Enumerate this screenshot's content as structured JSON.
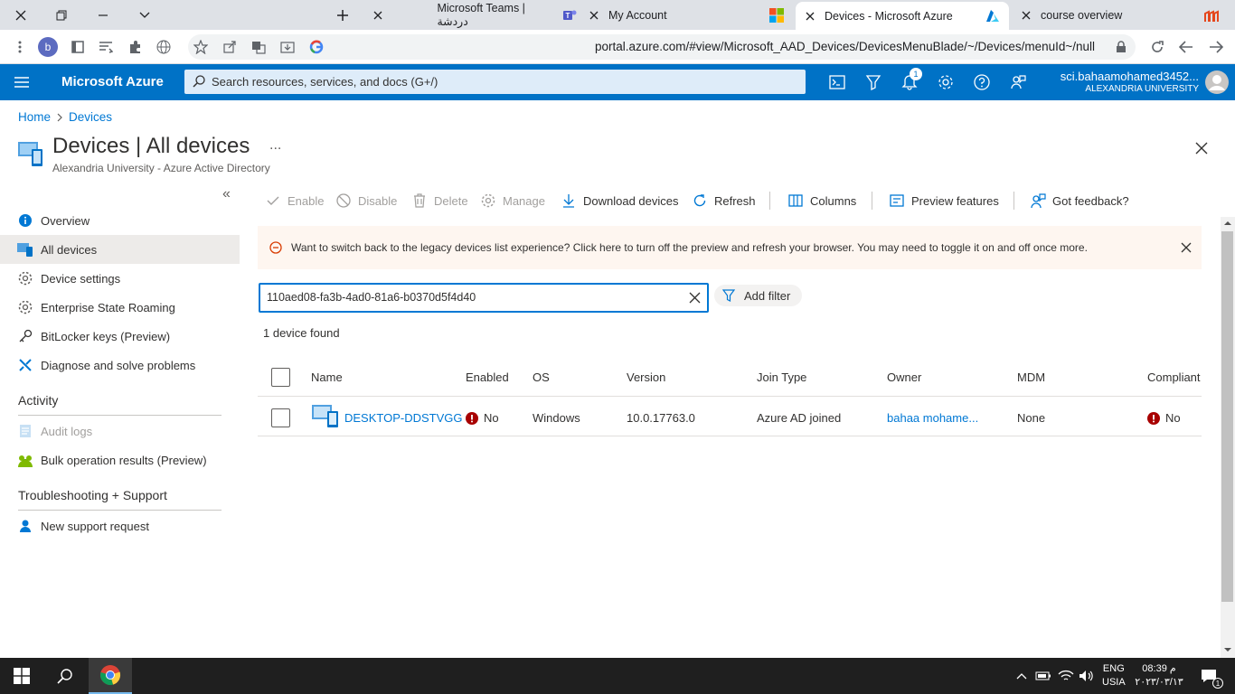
{
  "browser": {
    "tabs": [
      {
        "title": "Microsoft Teams | دردشة"
      },
      {
        "title": "My Account"
      },
      {
        "title": "Devices - Microsoft Azure"
      },
      {
        "title": "course overview"
      }
    ],
    "url": "portal.azure.com/#view/Microsoft_AAD_Devices/DevicesMenuBlade/~/Devices/menuId~/null",
    "profile_letter": "b"
  },
  "azure_header": {
    "brand": "Microsoft Azure",
    "search_placeholder": "Search resources, services, and docs (G+/)",
    "notification_count": "1",
    "account_name": "sci.bahaamohamed3452...",
    "account_org": "ALEXANDRIA UNIVERSITY"
  },
  "breadcrumb": [
    "Home",
    "Devices"
  ],
  "page": {
    "title": "Devices | All devices",
    "more": "...",
    "subtitle": "Alexandria University - Azure Active Directory"
  },
  "sidebar": {
    "collapse": "«",
    "items": [
      {
        "label": "Overview",
        "icon": "info-icon"
      },
      {
        "label": "All devices",
        "icon": "devices-icon",
        "selected": true
      },
      {
        "label": "Device settings",
        "icon": "gear-icon"
      },
      {
        "label": "Enterprise State Roaming",
        "icon": "gear-icon"
      },
      {
        "label": "BitLocker keys (Preview)",
        "icon": "key-icon"
      },
      {
        "label": "Diagnose and solve problems",
        "icon": "wrench-icon"
      }
    ],
    "activity_header": "Activity",
    "activity_items": [
      {
        "label": "Audit logs",
        "icon": "log-icon"
      },
      {
        "label": "Bulk operation results (Preview)",
        "icon": "people-icon"
      }
    ],
    "support_header": "Troubleshooting + Support",
    "support_items": [
      {
        "label": "New support request",
        "icon": "person-icon"
      }
    ]
  },
  "toolbar": {
    "enable": "Enable",
    "disable": "Disable",
    "delete": "Delete",
    "manage": "Manage",
    "download": "Download devices",
    "refresh": "Refresh",
    "columns": "Columns",
    "preview": "Preview features",
    "feedback": "Got feedback?"
  },
  "banner": {
    "text": "Want to switch back to the legacy devices list experience? Click here to turn off the preview and refresh your browser. You may need to toggle it on and off once more."
  },
  "filter": {
    "value": "110aed08-fa3b-4ad0-81a6-b0370d5f4d40",
    "add_filter": "Add filter"
  },
  "result_count": "1 device found",
  "table": {
    "columns": [
      "Name",
      "Enabled",
      "OS",
      "Version",
      "Join Type",
      "Owner",
      "MDM",
      "Compliant"
    ],
    "rows": [
      {
        "name": "DESKTOP-DDSTVGG",
        "enabled": "No",
        "os": "Windows",
        "version": "10.0.17763.0",
        "join_type": "Azure AD joined",
        "owner": "bahaa mohame...",
        "mdm": "None",
        "compliant": "No"
      }
    ]
  },
  "taskbar": {
    "lang": "ENG",
    "region": "USIA",
    "time": "08:39 م",
    "date": "٢٠٢٣/٠٣/١٣",
    "notif_count": "1"
  },
  "colors": {
    "azure_blue": "#0072c6",
    "link": "#0078d4",
    "error_red": "#a80000",
    "banner_bg": "#fef6f0",
    "warn_orange": "#d83b01"
  }
}
